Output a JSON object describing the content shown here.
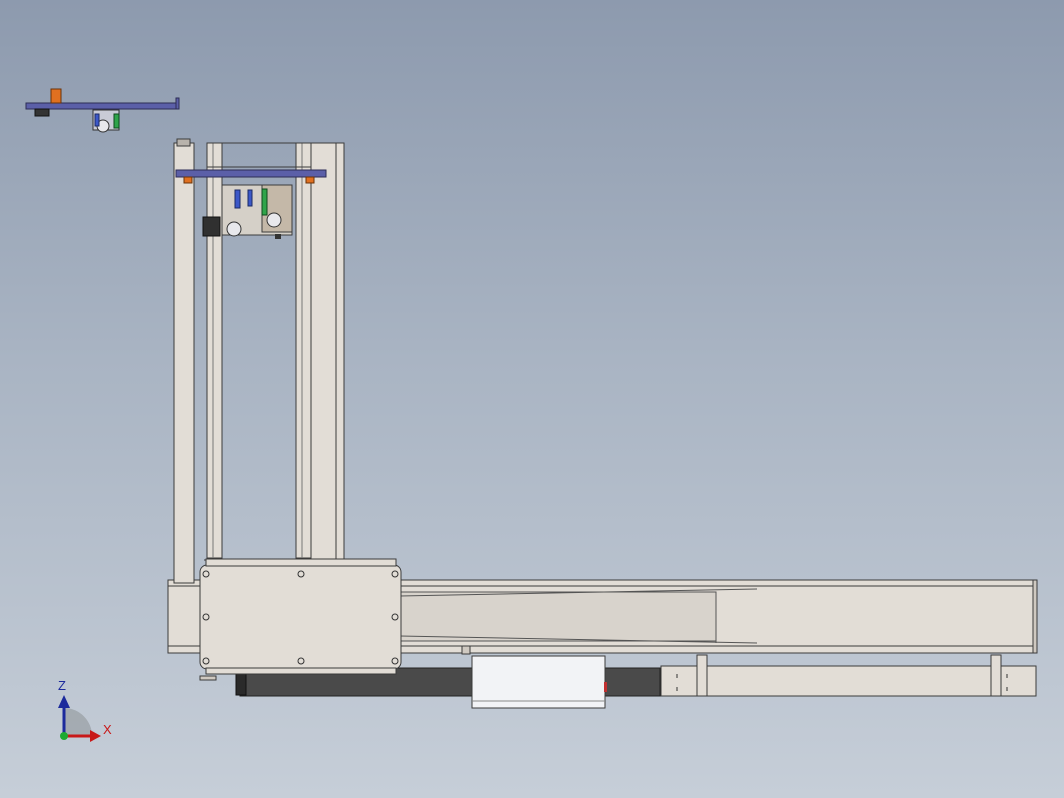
{
  "viewport": {
    "background_top": "#8d9aae",
    "background_bottom": "#c6ced8"
  },
  "model": {
    "frame_color": "#e2ddd6",
    "edge_color": "#3b3b3b",
    "plate_color": "#5b5fa8",
    "accent_color": "#e07020",
    "rail_dark_color": "#4a4a4a",
    "rail_light_color": "#f2f3f6"
  },
  "triad": {
    "z_label": "Z",
    "x_label": "X",
    "z_color": "#1c2a9c",
    "x_color": "#c81818",
    "y_color": "#1eaa32"
  }
}
